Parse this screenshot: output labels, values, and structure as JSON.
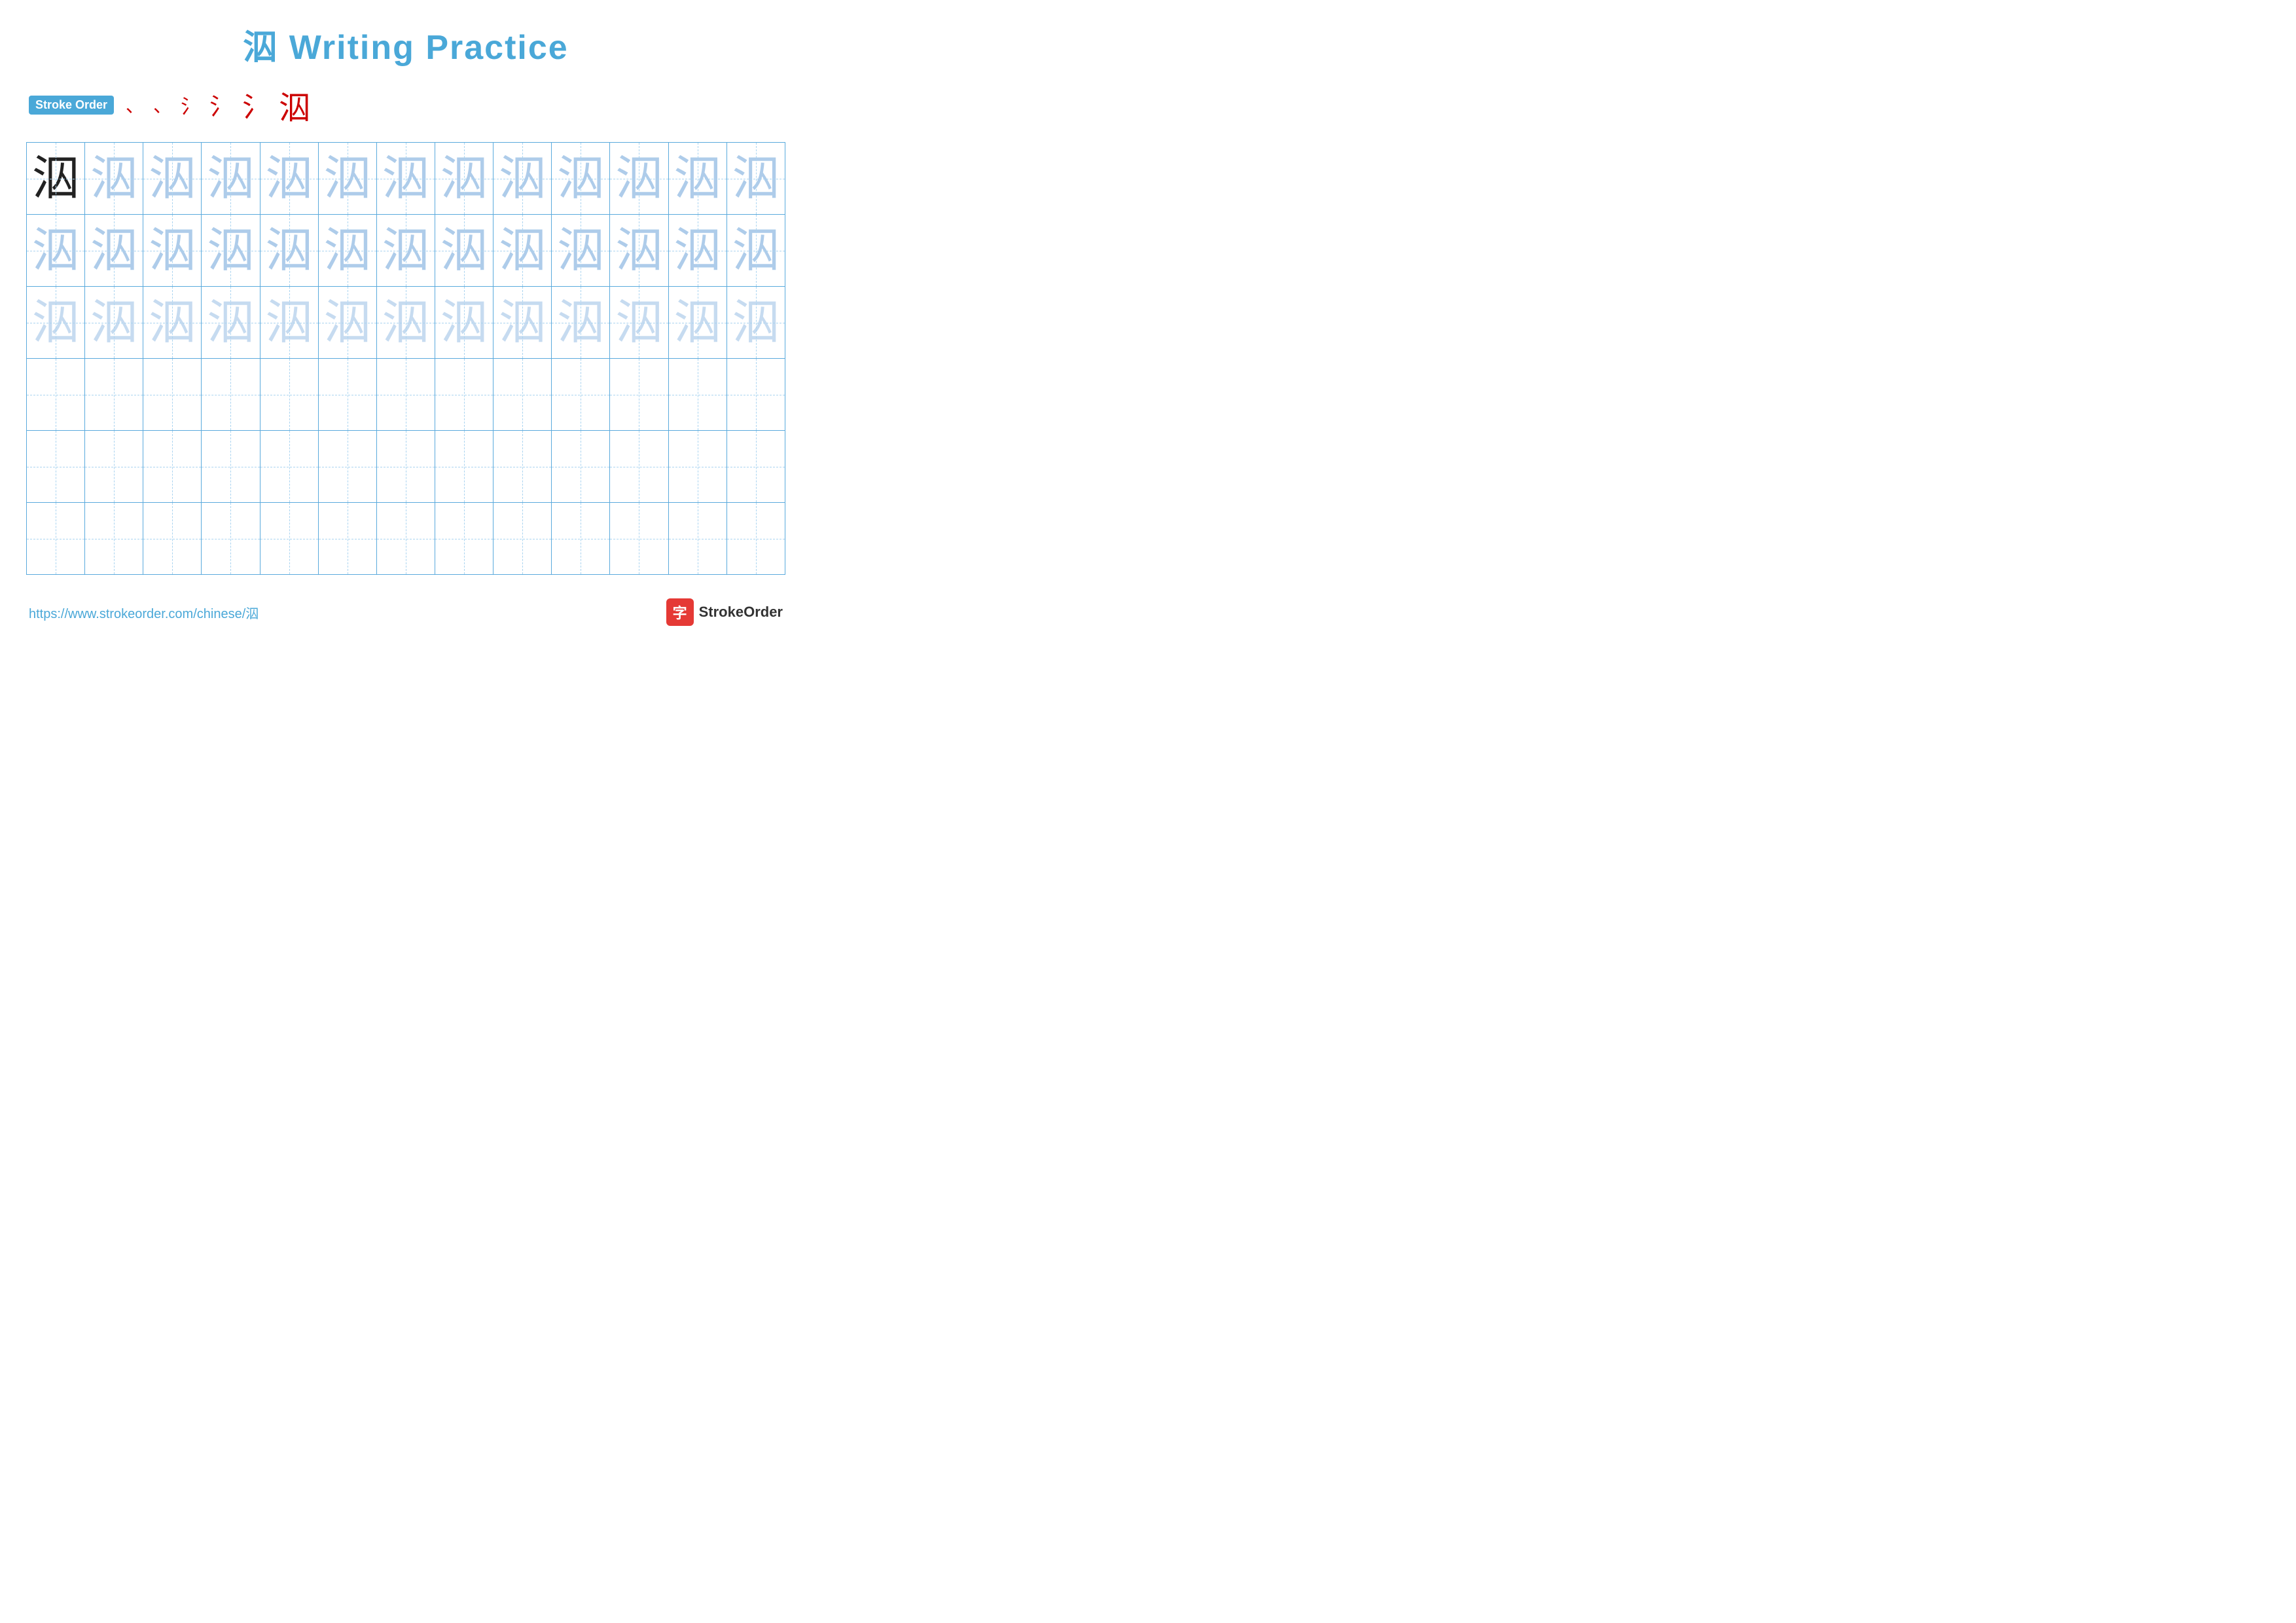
{
  "page": {
    "title": "泅 Writing Practice",
    "title_char": "泅",
    "title_text": " Writing Practice"
  },
  "stroke_order": {
    "badge_label": "Stroke Order",
    "steps": [
      "、",
      "、",
      "氵",
      "氵",
      "氵",
      "泅"
    ]
  },
  "grid": {
    "rows": 6,
    "cols": 13,
    "character": "泅",
    "row_types": [
      "dark",
      "light1",
      "light2",
      "empty",
      "empty",
      "empty"
    ]
  },
  "footer": {
    "url": "https://www.strokeorder.com/chinese/泅",
    "brand_name": "StrokeOrder",
    "brand_icon": "字"
  }
}
